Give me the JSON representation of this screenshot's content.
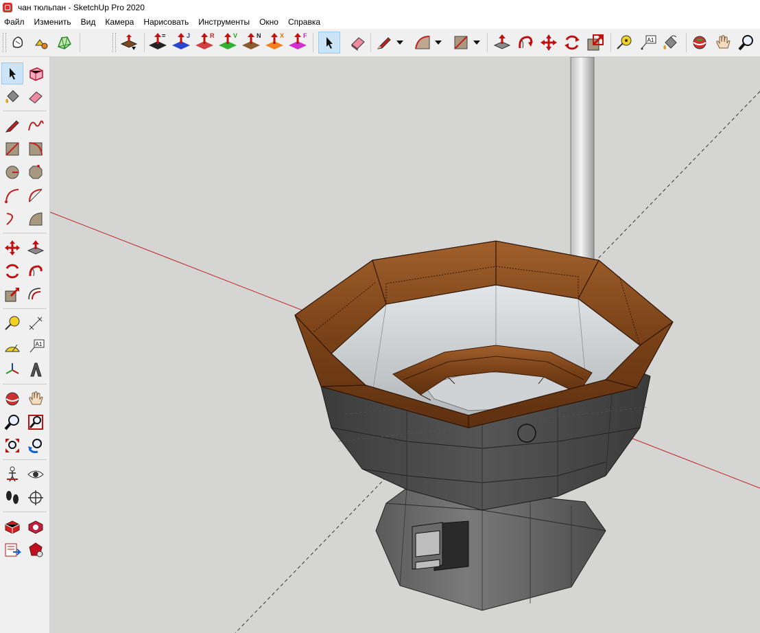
{
  "window": {
    "title": "чан тюльпан - SketchUp Pro 2020"
  },
  "menu": [
    "Файл",
    "Изменить",
    "Вид",
    "Камера",
    "Нарисовать",
    "Инструменты",
    "Окно",
    "Справка"
  ],
  "toolbar": {
    "badges": {
      "j": "J",
      "r": "R",
      "v": "V",
      "n": "N",
      "x": "X",
      "f": "F",
      "eq": "=",
      "a1": "A1"
    },
    "colors": {
      "j": "#2040c0",
      "r": "#d02020",
      "v": "#20a020",
      "n": "#202020",
      "x": "#e07010",
      "f": "#c020c0"
    }
  },
  "icons_top": [
    "sketchy-edges-icon",
    "push-pull-3d-icon",
    "sandbox-icon",
    "solid-inspector-icon",
    "flip-along-icon",
    "select-icon",
    "eraser-icon",
    "pencil-line-icon",
    "arc-icon",
    "rectangle-icon",
    "push-pull-icon",
    "follow-me-icon",
    "move-icon",
    "rotate-icon",
    "scale-icon",
    "tape-measure-icon",
    "text-icon",
    "paint-bucket-icon",
    "orbit-icon",
    "pan-icon",
    "zoom-icon"
  ],
  "icons_left": [
    "select-icon",
    "make-component-icon",
    "paint-bucket-icon",
    "eraser-icon",
    "line-icon",
    "freehand-icon",
    "rectangle-icon",
    "rotated-rectangle-icon",
    "circle-icon",
    "polygon-icon",
    "arc-icon",
    "arc-2point-icon",
    "arc-3point-icon",
    "pie-icon",
    "move-icon",
    "push-pull-icon",
    "rotate-icon",
    "follow-me-icon",
    "scale-icon",
    "offset-icon",
    "tape-measure-icon",
    "dimension-icon",
    "protractor-icon",
    "text-icon",
    "axes-icon",
    "3d-text-icon",
    "orbit-icon",
    "pan-icon",
    "zoom-icon",
    "zoom-window-icon",
    "zoom-extents-icon",
    "previous-view-icon",
    "position-camera-icon",
    "look-around-icon",
    "walk-icon",
    "section-plane-icon",
    "3d-warehouse-icon",
    "extension-warehouse-icon",
    "layout-icon",
    "extension-manager-icon"
  ],
  "scene": {
    "background": "#d5d5d3",
    "wood": "#8a4e22",
    "tub_body": "#4a4a4a",
    "water": "#c8cccf",
    "axis_red": "#c02020",
    "axis_dashed": "#333333"
  }
}
